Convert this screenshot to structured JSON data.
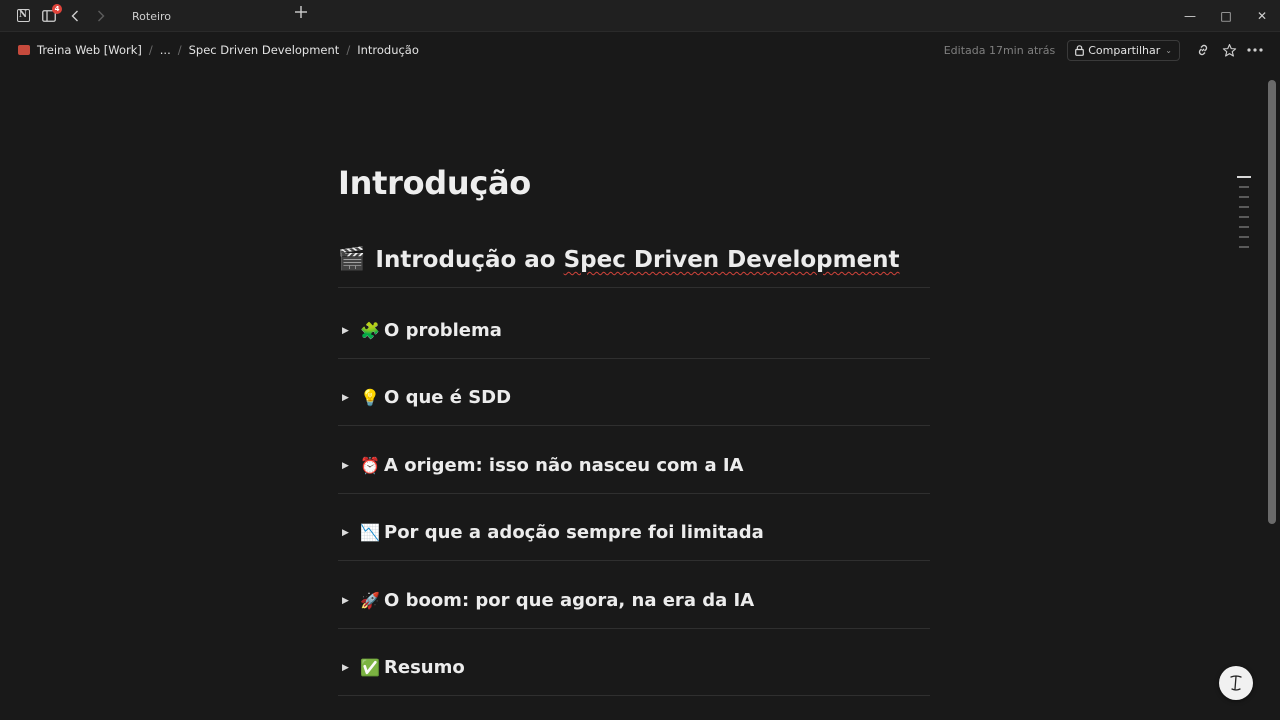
{
  "window": {
    "tab_title": "Roteiro",
    "notification_count": "4",
    "controls": {
      "minimize": "—",
      "maximize": "□",
      "close": "✕"
    }
  },
  "breadcrumb": {
    "workspace": "Treina Web [Work]",
    "ellipsis": "...",
    "parent": "Spec Driven Development",
    "current": "Introdução"
  },
  "toolbar": {
    "edited": "Editada 17min atrás",
    "share_label": "Compartilhar"
  },
  "page": {
    "title": "Introdução",
    "heading": {
      "emoji": "🎬",
      "text_plain": "Introdução ao ",
      "text_flagged": "Spec Driven Development"
    },
    "toggles": [
      {
        "emoji": "🧩",
        "label": "O problema"
      },
      {
        "emoji": "💡",
        "label": "O que é SDD"
      },
      {
        "emoji": "⏰",
        "label": "A origem: isso não nasceu com a IA"
      },
      {
        "emoji": "📉",
        "label": "Por que a adoção sempre foi limitada"
      },
      {
        "emoji": "🚀",
        "label": "O boom: por que agora, na era da IA"
      },
      {
        "emoji": "✅",
        "label": "Resumo"
      }
    ]
  },
  "colors": {
    "background": "#191919",
    "titlebar": "#202020",
    "text": "#ececec",
    "spellcheck": "#d0433a"
  }
}
